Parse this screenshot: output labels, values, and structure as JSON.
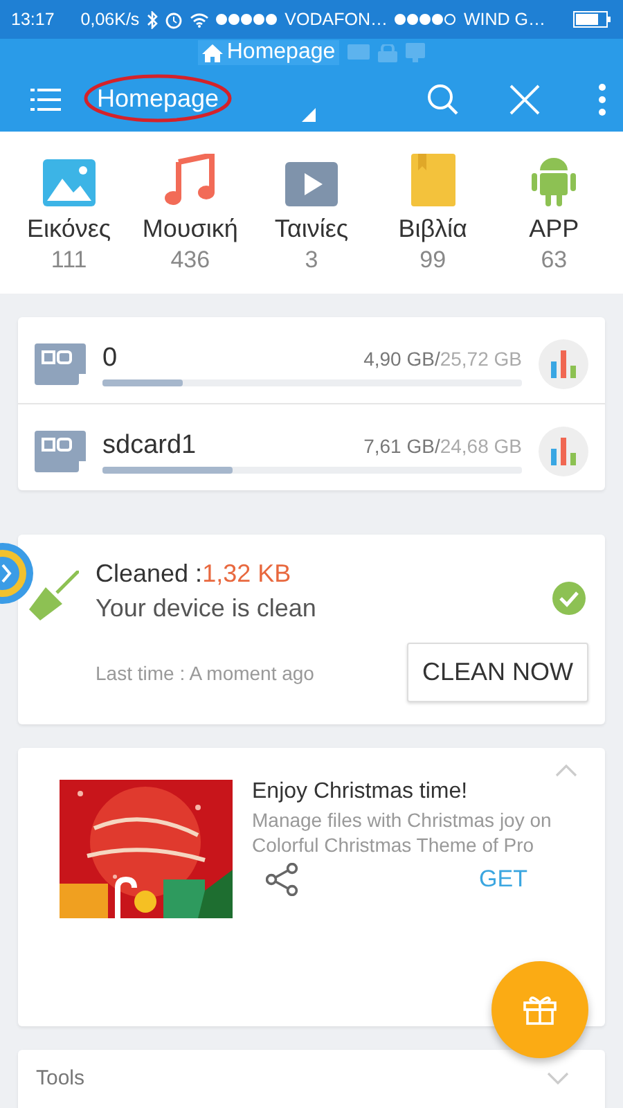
{
  "status_bar": {
    "time": "13:17",
    "speed": "0,06K/s",
    "carrier_1": "VODAFON…",
    "carrier_2": "WIND G…"
  },
  "title_strip": {
    "label": "Homepage"
  },
  "toolbar": {
    "title": "Homepage"
  },
  "categories": [
    {
      "kind": "images",
      "name": "Εικόνες",
      "count": "111"
    },
    {
      "kind": "music",
      "name": "Μουσική",
      "count": "436"
    },
    {
      "kind": "video",
      "name": "Ταινίες",
      "count": "3"
    },
    {
      "kind": "books",
      "name": "Βιβλία",
      "count": "99"
    },
    {
      "kind": "apps",
      "name": "APP",
      "count": "63"
    }
  ],
  "storage": [
    {
      "name": "0",
      "used": "4,90 GB/",
      "total": "25,72 GB",
      "level": 0.19
    },
    {
      "name": "sdcard1",
      "used": "7,61 GB/",
      "total": "24,68 GB",
      "level": 0.31
    }
  ],
  "cleaner": {
    "label": "Cleaned :",
    "amount": "1,32 KB",
    "status": "Your device is clean",
    "last_time": "Last time : A moment ago",
    "button": "CLEAN NOW"
  },
  "promo": {
    "title": "Enjoy Christmas time!",
    "description": "Manage files with Christmas joy on Colorful Christmas Theme of Pro",
    "button": "GET"
  },
  "tools": {
    "title": "Tools"
  }
}
